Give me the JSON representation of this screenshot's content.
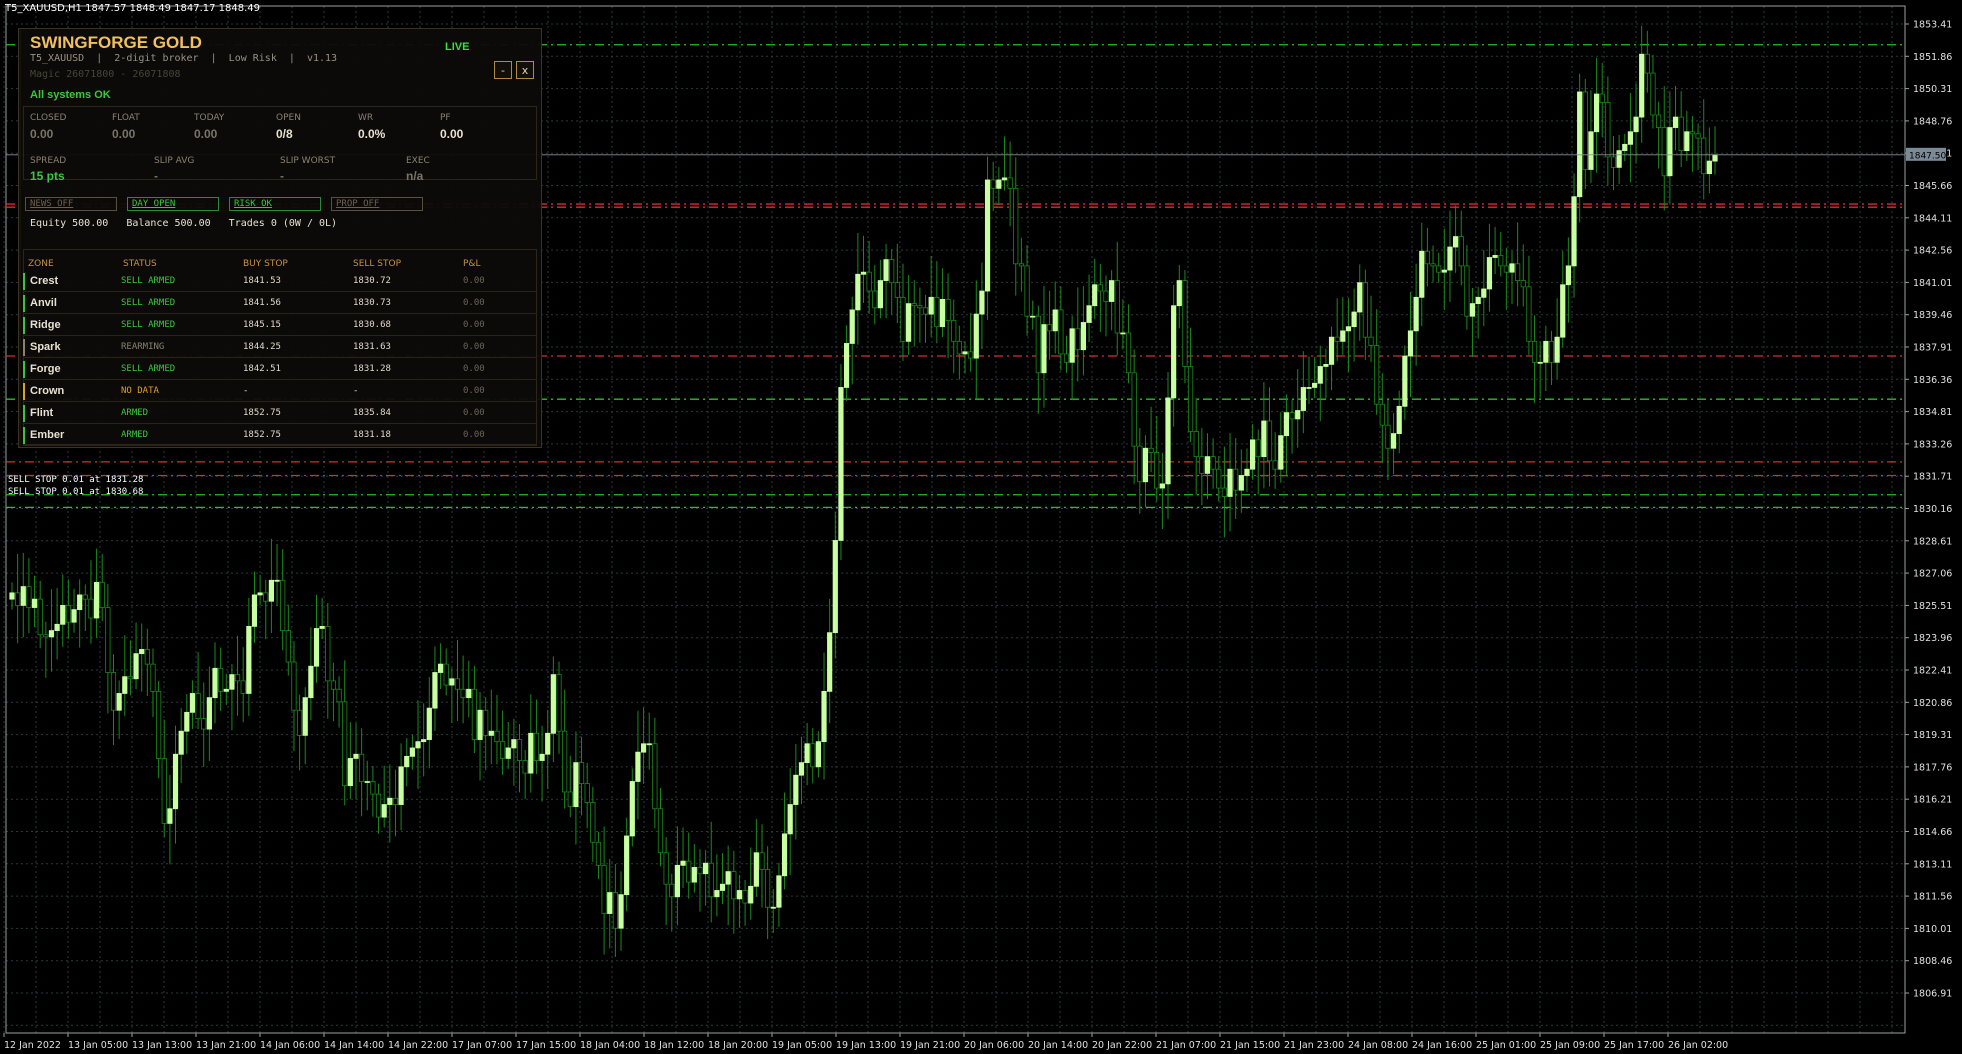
{
  "chart_header": "T5_XAUUSD,H1  1847.57 1848.49 1847.17 1848.49",
  "colors": {
    "background": "#000000",
    "grid": "#2a3b3b",
    "bull": "#c8ffa0",
    "bear": "#1a8a1a",
    "buy_stop": "#d03030",
    "sell_stop": "#28c028",
    "panel_accent": "#f0c060"
  },
  "order_labels": [
    "SELL STOP 0.01 at 1831.28",
    "SELL STOP 0.01 at 1830.68"
  ],
  "panel": {
    "title": "SWINGFORGE GOLD",
    "live": "LIVE",
    "subtitle": "T5_XAUUSD  |  2-digit broker  |  Low Risk  |  v1.13",
    "magic": "Magic 26071800 - 26071808",
    "min_label": "-",
    "close_label": "x",
    "status": "All systems OK",
    "stats": [
      {
        "label": "CLOSED",
        "value": "0.00"
      },
      {
        "label": "FLOAT",
        "value": "0.00"
      },
      {
        "label": "TODAY",
        "value": "0.00"
      },
      {
        "label": "OPEN",
        "value": "0/8"
      },
      {
        "label": "WR",
        "value": "0.0%"
      },
      {
        "label": "PF",
        "value": "0.00"
      }
    ],
    "exec": [
      {
        "label": "SPREAD",
        "value": "15 pts"
      },
      {
        "label": "SLIP AVG",
        "value": "-"
      },
      {
        "label": "SLIP WORST",
        "value": "-"
      },
      {
        "label": "EXEC",
        "value": "n/a"
      }
    ],
    "flags": [
      {
        "label": "NEWS OFF",
        "state": "off"
      },
      {
        "label": "DAY OPEN",
        "state": "on"
      },
      {
        "label": "RISK OK",
        "state": "on"
      },
      {
        "label": "PROP OFF",
        "state": "off"
      }
    ],
    "equity_line": "Equity 500.00   Balance 500.00   Trades 0 (0W / 0L)",
    "zone_headers": [
      "ZONE",
      "STATUS",
      "BUY STOP",
      "SELL STOP",
      "P&L"
    ],
    "zones": [
      {
        "name": "Crest",
        "status": "SELL ARMED",
        "buy": "1841.53",
        "sell": "1830.72",
        "pl": "0.00",
        "bar": "green",
        "st": "green"
      },
      {
        "name": "Anvil",
        "status": "SELL ARMED",
        "buy": "1841.56",
        "sell": "1830.73",
        "pl": "0.00",
        "bar": "green",
        "st": "green"
      },
      {
        "name": "Ridge",
        "status": "SELL ARMED",
        "buy": "1845.15",
        "sell": "1830.68",
        "pl": "0.00",
        "bar": "green",
        "st": "green"
      },
      {
        "name": "Spark",
        "status": "REARMING",
        "buy": "1844.25",
        "sell": "1831.63",
        "pl": "0.00",
        "bar": "gray",
        "st": "gray"
      },
      {
        "name": "Forge",
        "status": "SELL ARMED",
        "buy": "1842.51",
        "sell": "1831.28",
        "pl": "0.00",
        "bar": "green",
        "st": "green"
      },
      {
        "name": "Crown",
        "status": "NO DATA",
        "buy": "-",
        "sell": "-",
        "pl": "0.00",
        "bar": "orange",
        "st": "orange"
      },
      {
        "name": "Flint",
        "status": "ARMED",
        "buy": "1852.75",
        "sell": "1835.84",
        "pl": "0.00",
        "bar": "green",
        "st": "green"
      },
      {
        "name": "Ember",
        "status": "ARMED",
        "buy": "1852.75",
        "sell": "1831.18",
        "pl": "0.00",
        "bar": "green",
        "st": "green"
      }
    ]
  },
  "chart_data": {
    "type": "candlestick",
    "timeframe": "H1",
    "symbol": "T5_XAUUSD",
    "current_price_label": "1847.50",
    "y_ticks": [
      "1853.41",
      "1851.86",
      "1850.31",
      "1848.76",
      "1847.21",
      "1845.66",
      "1844.11",
      "1842.56",
      "1841.01",
      "1839.46",
      "1837.91",
      "1836.36",
      "1834.81",
      "1833.26",
      "1831.71",
      "1830.16",
      "1828.61",
      "1827.06",
      "1825.51",
      "1823.96",
      "1822.41",
      "1820.86",
      "1819.31",
      "1817.76",
      "1816.21",
      "1814.66",
      "1813.11",
      "1811.56",
      "1810.01",
      "1808.46",
      "1806.91"
    ],
    "x_ticks": [
      "12 Jan 2022",
      "13 Jan 05:00",
      "13 Jan 13:00",
      "13 Jan 21:00",
      "14 Jan 06:00",
      "14 Jan 14:00",
      "14 Jan 22:00",
      "17 Jan 07:00",
      "17 Jan 15:00",
      "18 Jan 04:00",
      "18 Jan 12:00",
      "18 Jan 20:00",
      "19 Jan 05:00",
      "19 Jan 13:00",
      "19 Jan 21:00",
      "20 Jan 06:00",
      "20 Jan 14:00",
      "20 Jan 22:00",
      "21 Jan 07:00",
      "21 Jan 15:00",
      "21 Jan 23:00",
      "24 Jan 08:00",
      "24 Jan 16:00",
      "25 Jan 01:00",
      "25 Jan 09:00",
      "25 Jan 17:00",
      "26 Jan 02:00"
    ],
    "closes": [
      1826.6,
      1826.0,
      1826.9,
      1825.9,
      1826.3,
      1824.6,
      1824.5,
      1824.8,
      1825.1,
      1826.0,
      1825.2,
      1825.8,
      1826.5,
      1826.3,
      1825.4,
      1827.1,
      1825.9,
      1822.8,
      1821.0,
      1821.8,
      1822.6,
      1822.5,
      1823.7,
      1823.9,
      1823.2,
      1821.9,
      1818.7,
      1815.6,
      1816.3,
      1818.9,
      1820.0,
      1820.9,
      1821.8,
      1820.6,
      1820.1,
      1821.6,
      1823.0,
      1821.9,
      1822.0,
      1822.7,
      1822.4,
      1821.8,
      1825.0,
      1826.5,
      1826.6,
      1826.2,
      1827.2,
      1827.2,
      1824.8,
      1823.3,
      1821.0,
      1819.8,
      1821.6,
      1823.1,
      1824.9,
      1825.0,
      1822.4,
      1822.0,
      1821.4,
      1817.4,
      1818.7,
      1818.9,
      1817.6,
      1817.6,
      1817.0,
      1815.9,
      1816.5,
      1816.8,
      1816.5,
      1818.3,
      1818.8,
      1819.2,
      1819.5,
      1819.6,
      1821.1,
      1822.8,
      1823.2,
      1822.2,
      1822.5,
      1822.0,
      1821.6,
      1822.0,
      1819.6,
      1821.0,
      1819.8,
      1820.0,
      1819.5,
      1818.7,
      1819.2,
      1819.6,
      1818.6,
      1818.0,
      1819.9,
      1818.6,
      1818.9,
      1819.9,
      1822.7,
      1820.0,
      1817.1,
      1816.4,
      1818.5,
      1817.5,
      1816.6,
      1814.7,
      1813.6,
      1811.3,
      1812.3,
      1810.6,
      1812.2,
      1815.0,
      1817.6,
      1819.0,
      1819.4,
      1819.4,
      1816.3,
      1814.2,
      1812.7,
      1812.1,
      1813.6,
      1813.8,
      1812.8,
      1813.5,
      1813.2,
      1813.7,
      1812.1,
      1812.4,
      1812.7,
      1813.3,
      1812.0,
      1812.4,
      1811.8,
      1812.6,
      1814.2,
      1813.4,
      1811.6,
      1811.6,
      1813.1,
      1815.1,
      1816.5,
      1817.9,
      1818.5,
      1819.4,
      1818.3,
      1819.5,
      1821.9,
      1824.7,
      1829.1,
      1836.4,
      1838.5,
      1840.1,
      1841.8,
      1841.9,
      1841.0,
      1840.2,
      1841.5,
      1842.5,
      1841.4,
      1840.7,
      1838.6,
      1840.4,
      1840.3,
      1840.2,
      1839.9,
      1840.7,
      1839.3,
      1840.6,
      1839.6,
      1838.6,
      1838.0,
      1838.1,
      1837.8,
      1839.9,
      1841.0,
      1846.3,
      1845.9,
      1846.3,
      1846.4,
      1845.9,
      1842.3,
      1842.2,
      1839.8,
      1839.8,
      1837.1,
      1839.4,
      1839.1,
      1840.1,
      1838.0,
      1837.6,
      1839.2,
      1838.2,
      1839.5,
      1840.3,
      1841.3,
      1841.0,
      1840.5,
      1841.5,
      1839.0,
      1839.0,
      1837.1,
      1833.6,
      1831.9,
      1833.5,
      1833.3,
      1831.6,
      1831.8,
      1835.9,
      1840.3,
      1841.5,
      1837.4,
      1834.3,
      1833.1,
      1832.3,
      1833.1,
      1832.5,
      1831.6,
      1831.2,
      1832.5,
      1831.5,
      1832.2,
      1832.5,
      1833.9,
      1833.1,
      1834.8,
      1832.9,
      1832.5,
      1834.1,
      1835.2,
      1834.9,
      1835.3,
      1836.4,
      1836.4,
      1836.6,
      1837.4,
      1837.5,
      1838.8,
      1838.6,
      1839.1,
      1839.3,
      1840.0,
      1841.4,
      1838.8,
      1838.4,
      1835.6,
      1834.6,
      1833.5,
      1834.2,
      1835.5,
      1837.9,
      1839.1,
      1840.7,
      1842.9,
      1842.3,
      1842.2,
      1841.9,
      1842.0,
      1843.1,
      1843.6,
      1842.2,
      1839.8,
      1840.4,
      1840.7,
      1841.1,
      1842.6,
      1842.7,
      1842.2,
      1841.9,
      1842.3,
      1841.5,
      1841.2,
      1838.6,
      1837.6,
      1837.6,
      1838.6,
      1837.6,
      1838.8,
      1841.3,
      1842.2,
      1845.5,
      1850.5,
      1846.8,
      1848.6,
      1850.4,
      1850.0,
      1847.4,
      1846.9,
      1847.7,
      1848.0,
      1848.6,
      1849.3,
      1852.3,
      1851.4,
      1849.4,
      1848.8,
      1846.5,
      1848.8,
      1849.3,
      1847.7,
      1848.6,
      1848.5,
      1848.3,
      1846.6,
      1847.2,
      1847.5
    ],
    "price_lines": [
      {
        "price": 1852.75,
        "kind": "buy_stop_armed",
        "color": "#28c028"
      },
      {
        "price": 1845.15,
        "kind": "buy_stop",
        "color": "#d03030"
      },
      {
        "price": 1845.0,
        "kind": "buy_stop",
        "color": "#d03030"
      },
      {
        "price": 1837.9,
        "kind": "buy_stop",
        "color": "#d03030"
      },
      {
        "price": 1835.84,
        "kind": "sell_stop",
        "color": "#28c028"
      },
      {
        "price": 1832.85,
        "kind": "buy_stop",
        "color": "#d03030"
      },
      {
        "price": 1832.2,
        "kind": "buy_stop",
        "color": "#d03030"
      },
      {
        "price": 1831.28,
        "kind": "sell_stop",
        "color": "#28c028"
      },
      {
        "price": 1830.68,
        "kind": "sell_stop",
        "color": "#28c028"
      }
    ],
    "ylim": [
      1805.6,
      1854.6
    ]
  }
}
